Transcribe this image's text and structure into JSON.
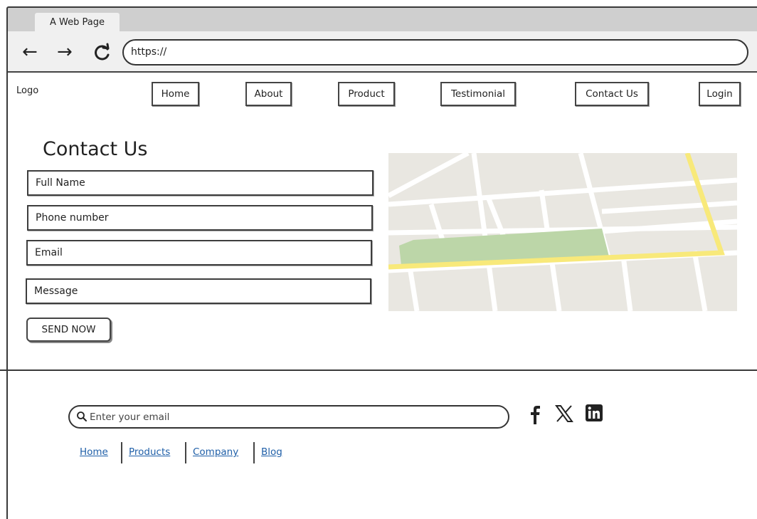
{
  "browser": {
    "tab_title": "A Web Page",
    "url": "https://",
    "back_icon": "arrow-left-icon",
    "forward_icon": "arrow-right-icon",
    "reload_icon": "reload-icon"
  },
  "header": {
    "logo": "Logo",
    "nav": {
      "home": "Home",
      "about": "About",
      "product": "Product",
      "testimonial": "Testimonial",
      "contact": "Contact Us",
      "login": "Login"
    }
  },
  "contact": {
    "title": "Contact Us",
    "full_name_placeholder": "Full Name",
    "phone_placeholder": "Phone number",
    "email_placeholder": "Email",
    "message_placeholder": "Message",
    "send_label": "SEND NOW"
  },
  "map": {
    "land_color": "#e9e7e1",
    "road_color": "#ffffff",
    "highway_color": "#f8e97a",
    "park_color": "#bcd6a8"
  },
  "footer": {
    "email_placeholder": "Enter your email",
    "social": [
      "facebook-icon",
      "x-icon",
      "linkedin-icon"
    ],
    "links": {
      "home": "Home",
      "products": "Products",
      "company": "Company",
      "blog": "Blog"
    },
    "link_color": "#1f5fa8"
  }
}
